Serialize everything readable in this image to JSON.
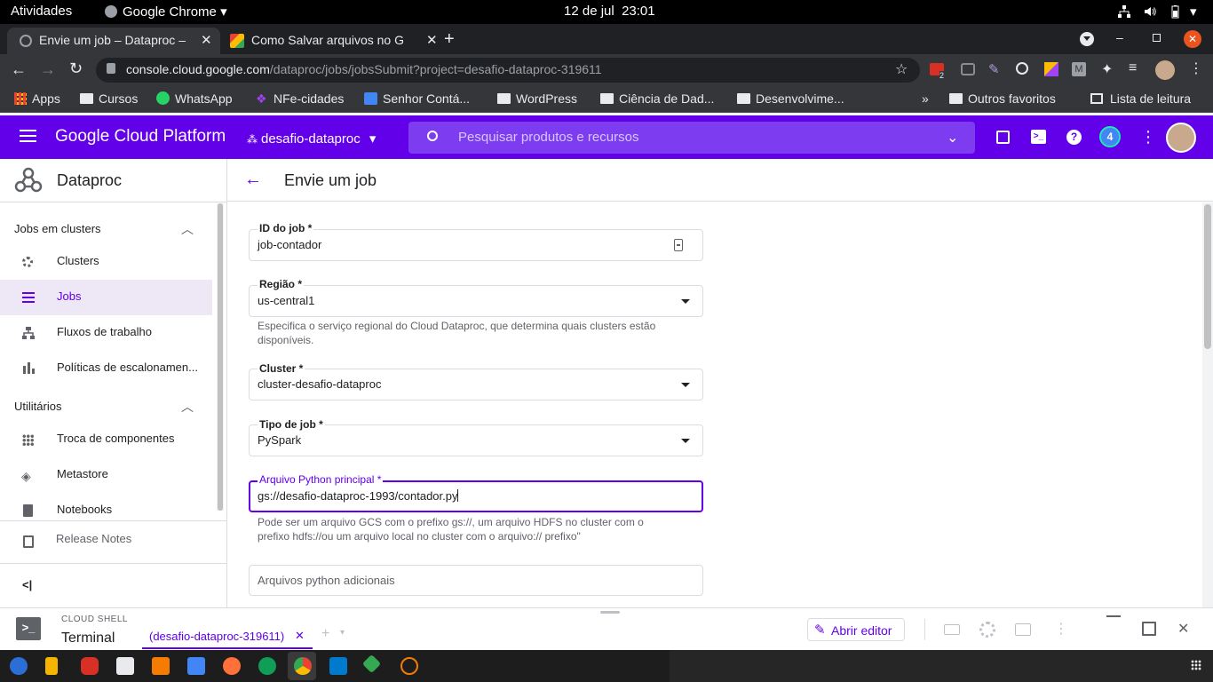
{
  "os_bar": {
    "activities": "Atividades",
    "app": "Google Chrome",
    "date": "12 de jul",
    "time": "23:01"
  },
  "tabs": [
    {
      "title": "Envie um job – Dataproc – ",
      "active": true
    },
    {
      "title": "Como Salvar arquivos no G",
      "active": false
    }
  ],
  "omnibox": {
    "host": "console.cloud.google.com",
    "path": "/dataproc/jobs/jobsSubmit?project=desafio-dataproc-319611"
  },
  "extensions": {
    "badge_count": "2"
  },
  "bookmarks": {
    "items": [
      "Apps",
      "Cursos",
      "WhatsApp",
      "NFe-cidades",
      "Senhor Contá...",
      "WordPress",
      "Ciência de Dad...",
      "Desenvolvime..."
    ],
    "more": "»",
    "other": "Outros favoritos",
    "reading": "Lista de leitura"
  },
  "gcp": {
    "brand": "Google Cloud Platform",
    "project": "desafio-dataproc",
    "search_placeholder": "Pesquisar produtos e recursos",
    "notif_count": "4"
  },
  "sidebar": {
    "product": "Dataproc",
    "section1": "Jobs em clusters",
    "items1": [
      "Clusters",
      "Jobs",
      "Fluxos de trabalho",
      "Políticas de escalonamen..."
    ],
    "section2": "Utilitários",
    "items2": [
      "Troca de componentes",
      "Metastore",
      "Notebooks"
    ],
    "release_notes": "Release Notes",
    "collapse": "<|"
  },
  "page": {
    "title": "Envie um job",
    "job_id": {
      "label": "ID do job *",
      "value": "job-contador"
    },
    "region": {
      "label": "Região *",
      "value": "us-central1",
      "hint": "Especifica o serviço regional do Cloud Dataproc, que determina quais clusters estão disponíveis."
    },
    "cluster": {
      "label": "Cluster *",
      "value": "cluster-desafio-dataproc"
    },
    "job_type": {
      "label": "Tipo de job *",
      "value": "PySpark"
    },
    "main_file": {
      "label": "Arquivo Python principal *",
      "value": "gs://desafio-dataproc-1993/contador.py",
      "hint": "Pode ser um arquivo GCS com o prefixo gs://, um arquivo HDFS no cluster com o prefixo hdfs://ou um arquivo local no cluster com o arquivo:// prefixo\""
    },
    "extra_files": {
      "placeholder": "Arquivos python adicionais"
    }
  },
  "cloud_shell": {
    "header": "CLOUD SHELL",
    "title": "Terminal",
    "tab": "(desafio-dataproc-319611)",
    "open_editor": "Abrir editor"
  },
  "colors": {
    "gcp_purple": "#6200ea",
    "chrome_dark": "#35363a",
    "accent": "#6200ea"
  }
}
